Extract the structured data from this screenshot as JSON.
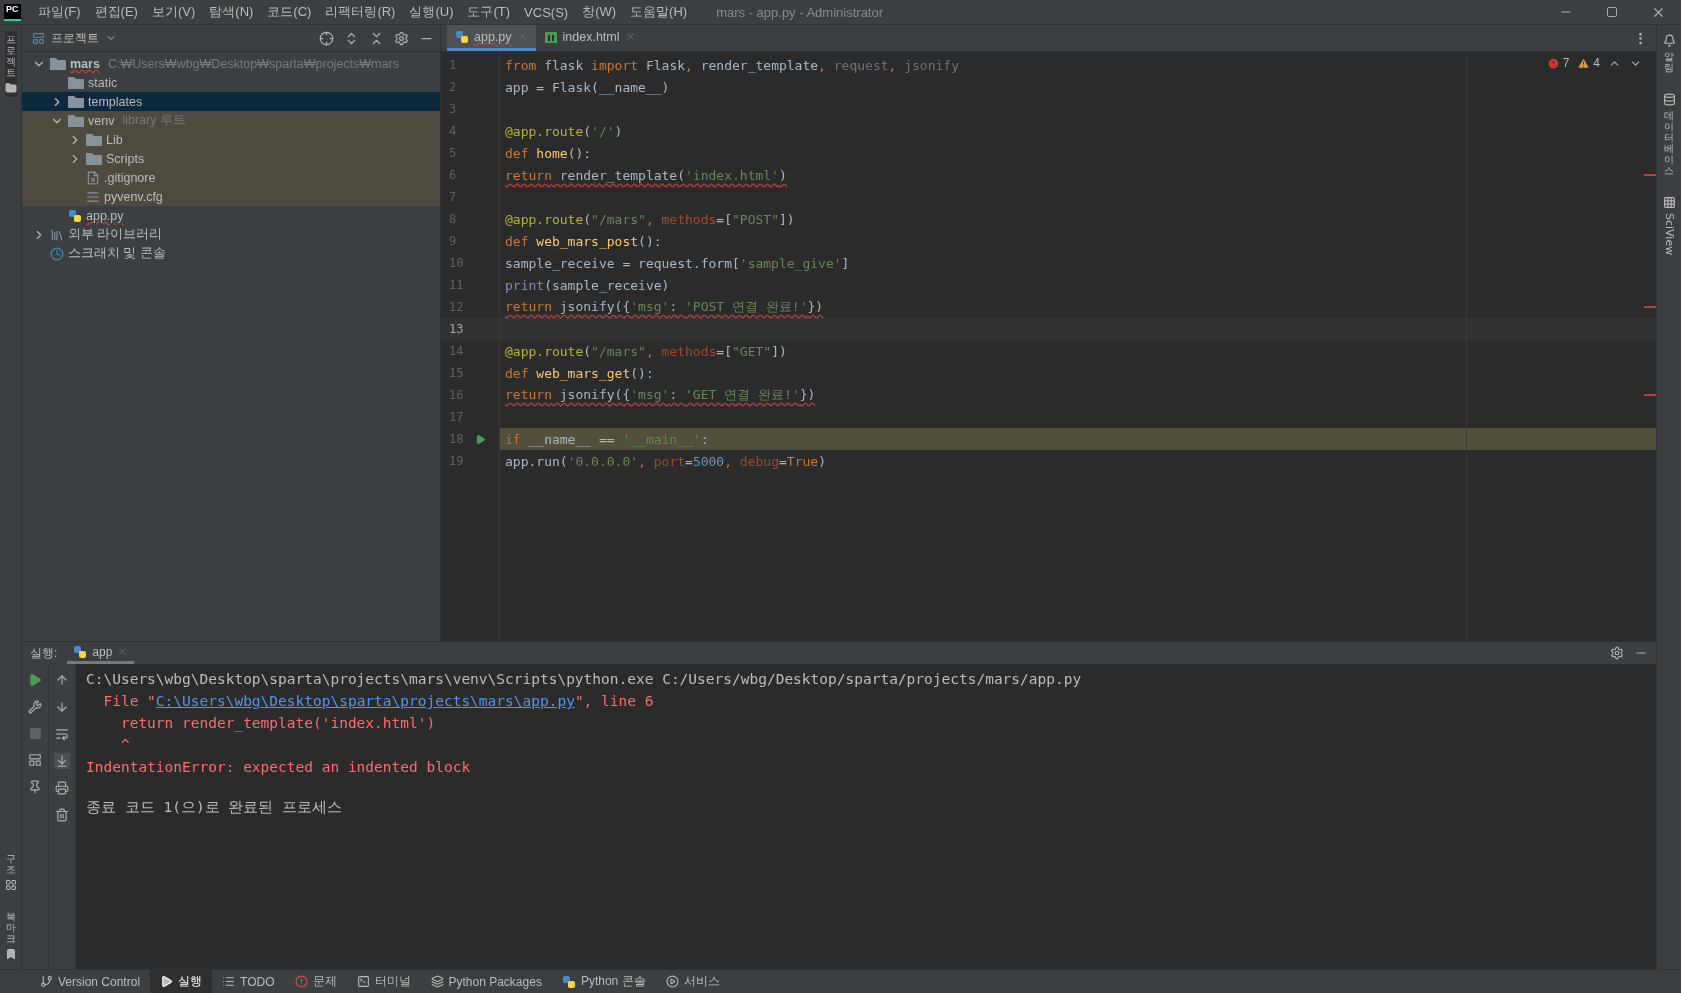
{
  "menubar": {
    "logo": "PC",
    "menus": [
      "파일(F)",
      "편집(E)",
      "보기(V)",
      "탐색(N)",
      "코드(C)",
      "리팩터링(R)",
      "실행(U)",
      "도구(T)",
      "VCS(S)",
      "창(W)",
      "도움말(H)"
    ],
    "title": "mars - app.py - Administrator"
  },
  "left_strip": {
    "top": [
      {
        "label": "프로젝트",
        "kind": "project"
      }
    ],
    "bottom": [
      {
        "label": "구조",
        "kind": "structure"
      },
      {
        "label": "북마크",
        "kind": "bookmarks"
      }
    ]
  },
  "right_strip": [
    {
      "label": "알림",
      "kind": "notifications",
      "rotated": false
    },
    {
      "label": "데이터베이스",
      "kind": "database",
      "rotated": false
    },
    {
      "label": "SciView",
      "kind": "sciview",
      "rotated": true
    }
  ],
  "project": {
    "title": "프로젝트",
    "tree": [
      {
        "name": "mars",
        "hint": "C:₩Users₩wbg₩Desktop₩sparta₩projects₩mars",
        "kind": "root",
        "expanded": true,
        "selected": false,
        "library": false,
        "error": true,
        "children": [
          {
            "name": "static",
            "kind": "folder",
            "selected": false,
            "library": false,
            "error": false
          },
          {
            "name": "templates",
            "kind": "folder",
            "expanded": false,
            "selected": true,
            "library": false,
            "error": false
          },
          {
            "name": "venv",
            "hint": "library 루트",
            "kind": "folder",
            "expanded": true,
            "selected": false,
            "library": true,
            "error": false,
            "children": [
              {
                "name": "Lib",
                "kind": "folder",
                "expanded": false,
                "selected": false,
                "library": true,
                "error": false
              },
              {
                "name": "Scripts",
                "kind": "folder",
                "expanded": false,
                "selected": false,
                "library": true,
                "error": false
              },
              {
                "name": ".gitignore",
                "kind": "ignore",
                "selected": false,
                "library": true,
                "error": false
              },
              {
                "name": "pyvenv.cfg",
                "kind": "config",
                "selected": false,
                "library": true,
                "error": false
              }
            ]
          },
          {
            "name": "app.py",
            "kind": "python",
            "selected": false,
            "library": false,
            "error": true
          }
        ]
      },
      {
        "name": "외부 라이브러리",
        "kind": "libraries",
        "expanded": false,
        "selected": false,
        "library": false,
        "error": false
      },
      {
        "name": "스크래치 및 콘솔",
        "kind": "scratches",
        "selected": false,
        "library": false,
        "error": false
      }
    ]
  },
  "editor": {
    "tabs": [
      {
        "label": "app.py",
        "kind": "python",
        "selected": true,
        "error": true
      },
      {
        "label": "index.html",
        "kind": "html",
        "selected": false,
        "error": false
      }
    ],
    "errors": "7",
    "warnings": "4",
    "lines": [
      {
        "number": "1",
        "current": false,
        "highlighted": false,
        "error": false,
        "tokens": [
          {
            "kind": "keyword",
            "text": "from"
          },
          {
            "kind": "plain",
            "text": " flask "
          },
          {
            "kind": "keyword",
            "text": "import"
          },
          {
            "kind": "plain",
            "text": " Flask"
          },
          {
            "kind": "keyword",
            "text": ","
          },
          {
            "kind": "plain",
            "text": " render_template"
          },
          {
            "kind": "keyword",
            "text": ","
          },
          {
            "kind": "unused",
            "text": " request"
          },
          {
            "kind": "keyword",
            "text": ","
          },
          {
            "kind": "unused",
            "text": " jsonify"
          }
        ]
      },
      {
        "number": "2",
        "current": false,
        "highlighted": false,
        "error": false,
        "tokens": [
          {
            "kind": "plain",
            "text": "app = Flask(__name__)"
          }
        ]
      },
      {
        "number": "3",
        "current": false,
        "highlighted": false
      },
      {
        "number": "4",
        "current": false,
        "highlighted": false,
        "error": false,
        "tokens": [
          {
            "kind": "decorator",
            "text": "@app.route"
          },
          {
            "kind": "plain",
            "text": "("
          },
          {
            "kind": "string",
            "text": "'/'"
          },
          {
            "kind": "plain",
            "text": ")"
          }
        ]
      },
      {
        "number": "5",
        "current": false,
        "highlighted": false,
        "error": false,
        "tokens": [
          {
            "kind": "keyword",
            "text": "def"
          },
          {
            "kind": "function",
            "text": " home"
          },
          {
            "kind": "plain",
            "text": "():"
          }
        ]
      },
      {
        "number": "6",
        "current": false,
        "highlighted": false,
        "error": true,
        "tokens": [
          {
            "kind": "keyword",
            "text": "return"
          },
          {
            "kind": "plain",
            "text": " render_template("
          },
          {
            "kind": "string",
            "text": "'index.html'"
          },
          {
            "kind": "plain",
            "text": ")"
          }
        ]
      },
      {
        "number": "7",
        "current": false,
        "highlighted": false
      },
      {
        "number": "8",
        "current": false,
        "highlighted": false,
        "error": false,
        "tokens": [
          {
            "kind": "decorator",
            "text": "@app.route"
          },
          {
            "kind": "plain",
            "text": "("
          },
          {
            "kind": "string",
            "text": "\"/mars\""
          },
          {
            "kind": "keyword",
            "text": ","
          },
          {
            "kind": "param",
            "text": " methods"
          },
          {
            "kind": "plain",
            "text": "=["
          },
          {
            "kind": "string",
            "text": "\"POST\""
          },
          {
            "kind": "plain",
            "text": "])"
          }
        ]
      },
      {
        "number": "9",
        "current": false,
        "highlighted": false,
        "error": false,
        "tokens": [
          {
            "kind": "keyword",
            "text": "def"
          },
          {
            "kind": "function",
            "text": " web_mars_post"
          },
          {
            "kind": "plain",
            "text": "():"
          }
        ]
      },
      {
        "number": "10",
        "current": false,
        "highlighted": false,
        "error": false,
        "tokens": [
          {
            "kind": "plain",
            "text": "sample_receive = request.form["
          },
          {
            "kind": "string",
            "text": "'sample_give'"
          },
          {
            "kind": "plain",
            "text": "]"
          }
        ]
      },
      {
        "number": "11",
        "current": false,
        "highlighted": false,
        "error": false,
        "tokens": [
          {
            "kind": "builtin",
            "text": "print"
          },
          {
            "kind": "plain",
            "text": "(sample_receive)"
          }
        ]
      },
      {
        "number": "12",
        "current": false,
        "highlighted": false,
        "error": true,
        "tokens": [
          {
            "kind": "keyword",
            "text": "return"
          },
          {
            "kind": "plain",
            "text": " jsonify({"
          },
          {
            "kind": "string",
            "text": "'msg'"
          },
          {
            "kind": "plain",
            "text": ": "
          },
          {
            "kind": "string",
            "text": "'POST 연결 완료!'"
          },
          {
            "kind": "plain",
            "text": "})"
          }
        ]
      },
      {
        "number": "13",
        "current": true,
        "highlighted": false
      },
      {
        "number": "14",
        "current": false,
        "highlighted": false,
        "error": false,
        "tokens": [
          {
            "kind": "decorator",
            "text": "@app.route"
          },
          {
            "kind": "plain",
            "text": "("
          },
          {
            "kind": "string",
            "text": "\"/mars\""
          },
          {
            "kind": "keyword",
            "text": ","
          },
          {
            "kind": "param",
            "text": " methods"
          },
          {
            "kind": "plain",
            "text": "=["
          },
          {
            "kind": "string",
            "text": "\"GET\""
          },
          {
            "kind": "plain",
            "text": "])"
          }
        ]
      },
      {
        "number": "15",
        "current": false,
        "highlighted": false,
        "error": false,
        "tokens": [
          {
            "kind": "keyword",
            "text": "def"
          },
          {
            "kind": "function",
            "text": " web_mars_get"
          },
          {
            "kind": "plain",
            "text": "():"
          }
        ]
      },
      {
        "number": "16",
        "current": false,
        "highlighted": false,
        "error": true,
        "tokens": [
          {
            "kind": "keyword",
            "text": "return"
          },
          {
            "kind": "plain",
            "text": " jsonify({"
          },
          {
            "kind": "string",
            "text": "'msg'"
          },
          {
            "kind": "plain",
            "text": ": "
          },
          {
            "kind": "string",
            "text": "'GET 연결 완료!'"
          },
          {
            "kind": "plain",
            "text": "})"
          }
        ]
      },
      {
        "number": "17",
        "current": false,
        "highlighted": false
      },
      {
        "number": "18",
        "current": false,
        "highlighted": true,
        "error": false,
        "tokens": [
          {
            "kind": "keyword",
            "text": "if"
          },
          {
            "kind": "plain",
            "text": " __name__ == "
          },
          {
            "kind": "string",
            "text": "'__main__'"
          },
          {
            "kind": "plain",
            "text": ":"
          }
        ]
      },
      {
        "number": "19",
        "current": false,
        "highlighted": false,
        "error": false,
        "tokens": [
          {
            "kind": "plain",
            "text": "app.run("
          },
          {
            "kind": "string",
            "text": "'0.0.0.0'"
          },
          {
            "kind": "keyword",
            "text": ","
          },
          {
            "kind": "param",
            "text": " port"
          },
          {
            "kind": "plain",
            "text": "="
          },
          {
            "kind": "number",
            "text": "5000"
          },
          {
            "kind": "keyword",
            "text": ","
          },
          {
            "kind": "param",
            "text": " debug"
          },
          {
            "kind": "plain",
            "text": "="
          },
          {
            "kind": "keyword",
            "text": "True"
          },
          {
            "kind": "plain",
            "text": ")"
          }
        ]
      }
    ]
  },
  "run": {
    "label": "실행:",
    "tabs": [
      {
        "label": "app",
        "selected": true
      }
    ],
    "console": [
      {
        "kind": "command",
        "segments": [
          {
            "kind": "plain",
            "text": "C:\\Users\\wbg\\Desktop\\sparta\\projects\\mars\\venv\\Scripts\\python.exe C:/Users/wbg/Desktop/sparta/projects/mars/app.py"
          }
        ]
      },
      {
        "kind": "error",
        "segments": [
          {
            "kind": "error",
            "text": "  File \""
          },
          {
            "kind": "link",
            "text": "C:\\Users\\wbg\\Desktop\\sparta\\projects\\mars\\app.py"
          },
          {
            "kind": "error",
            "text": "\", line 6"
          }
        ]
      },
      {
        "kind": "error",
        "segments": [
          {
            "kind": "error",
            "text": "    return render_template('index.html')"
          }
        ]
      },
      {
        "kind": "error",
        "segments": [
          {
            "kind": "error",
            "text": "    ^"
          }
        ]
      },
      {
        "kind": "error",
        "segments": [
          {
            "kind": "error",
            "text": "IndentationError: expected an indented block"
          }
        ]
      },
      {
        "kind": "exit",
        "segments": [
          {
            "kind": "plain",
            "text": "종료 코드 1(으)로 완료된 프로세스"
          }
        ]
      }
    ]
  },
  "status_bar": {
    "tabs": [
      {
        "label": "Version Control",
        "kind": "git",
        "selected": false
      },
      {
        "label": "실행",
        "kind": "run",
        "selected": true
      },
      {
        "label": "TODO",
        "kind": "todo",
        "selected": false
      },
      {
        "label": "문제",
        "kind": "problems",
        "selected": false
      },
      {
        "label": "터미널",
        "kind": "terminal",
        "selected": false
      },
      {
        "label": "Python Packages",
        "kind": "packages",
        "selected": false
      },
      {
        "label": "Python 콘솔",
        "kind": "python",
        "selected": false
      },
      {
        "label": "서비스",
        "kind": "services",
        "selected": false
      }
    ]
  }
}
